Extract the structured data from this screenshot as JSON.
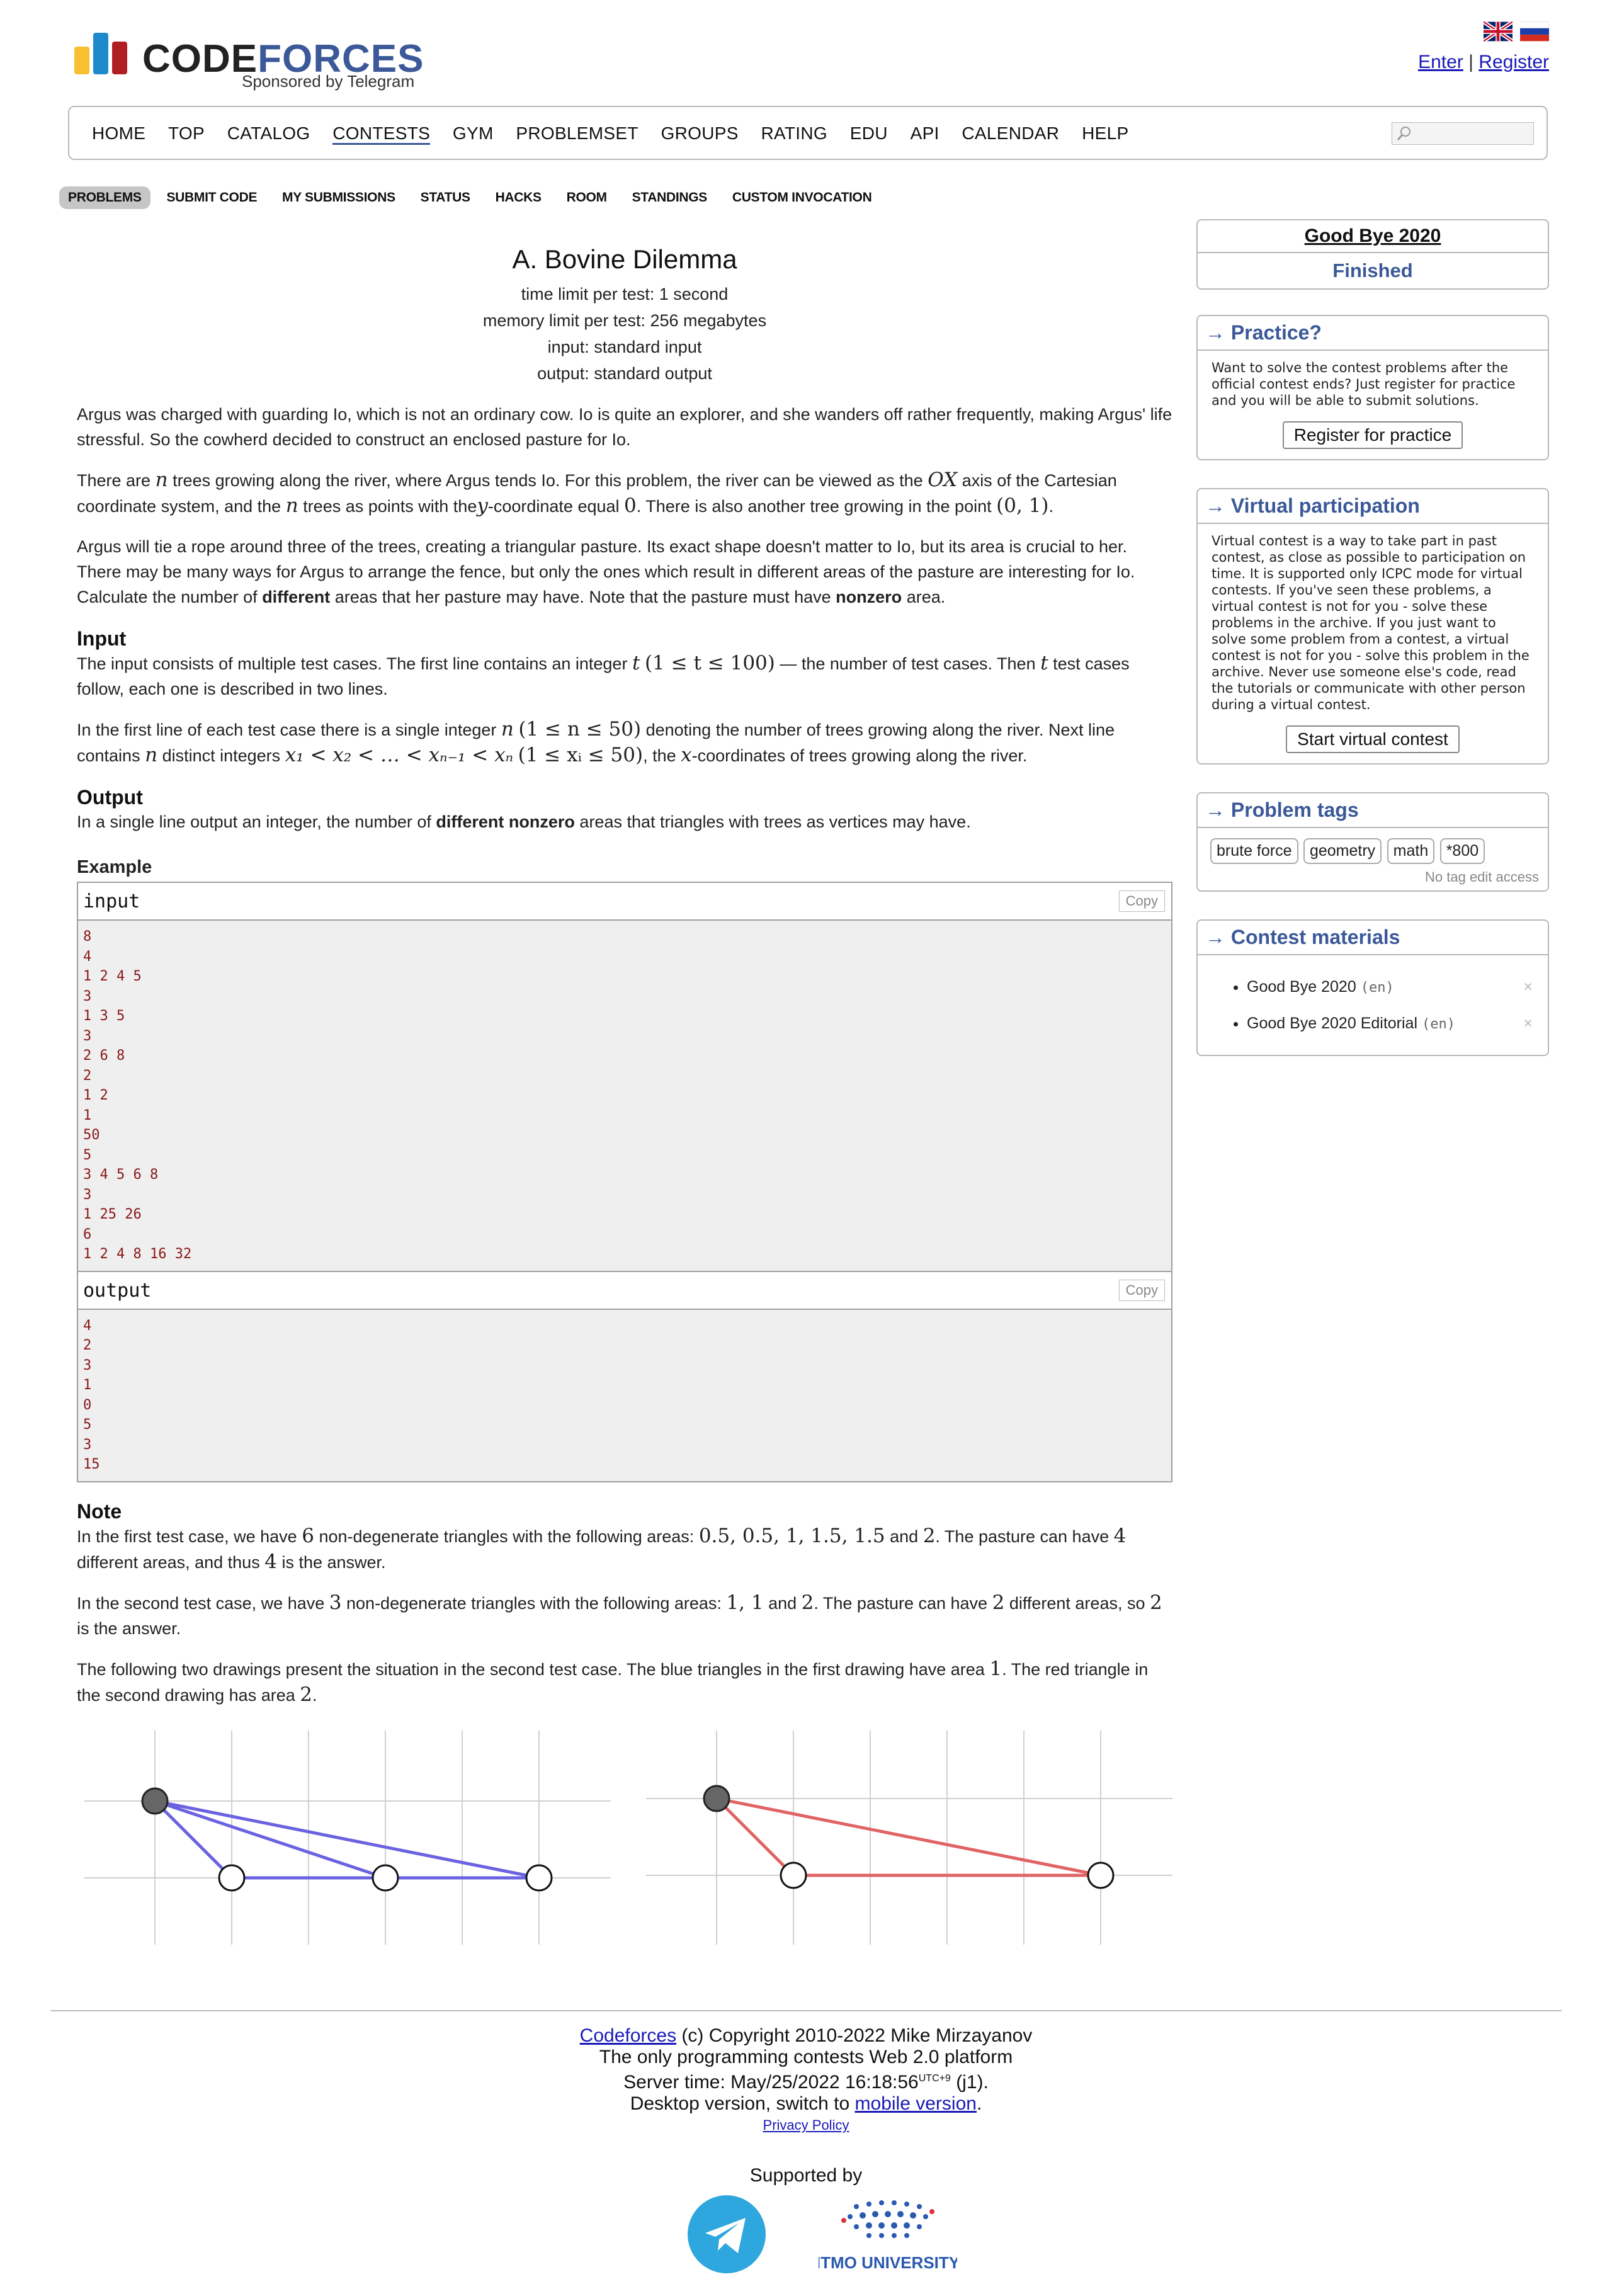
{
  "brand": {
    "name_part1": "CODE",
    "name_part2": "FORCES",
    "sponsor": "Sponsored by Telegram"
  },
  "auth": {
    "enter": "Enter",
    "separator": "|",
    "register": "Register"
  },
  "menu": [
    "HOME",
    "TOP",
    "CATALOG",
    "CONTESTS",
    "GYM",
    "PROBLEMSET",
    "GROUPS",
    "RATING",
    "EDU",
    "API",
    "CALENDAR",
    "HELP"
  ],
  "subtabs": [
    "PROBLEMS",
    "SUBMIT CODE",
    "MY SUBMISSIONS",
    "STATUS",
    "HACKS",
    "ROOM",
    "STANDINGS",
    "CUSTOM INVOCATION"
  ],
  "problem": {
    "title": "A. Bovine Dilemma",
    "time_limit": "time limit per test: 1 second",
    "memory_limit": "memory limit per test: 256 megabytes",
    "input_type": "input: standard input",
    "output_type": "output: standard output",
    "p1": "Argus was charged with guarding Io, which is not an ordinary cow. Io is quite an explorer, and she wanders off rather frequently, making Argus' life stressful. So the cowherd decided to construct an enclosed pasture for Io.",
    "p2a": "There are",
    "p2b": "trees growing along the river, where Argus tends Io. For this problem, the river can be viewed as the",
    "p2c": "axis of the Cartesian coordinate system, and the",
    "p2d": "trees as points with the",
    "p2e": "-coordinate equal",
    "p2f": ". There is also another tree growing in the point",
    "p2g": ".",
    "p3a": "Argus will tie a rope around three of the trees, creating a triangular pasture. Its exact shape doesn't matter to Io, but its area is crucial to her. There may be many ways for Argus to arrange the fence, but only the ones which result in different areas of the pasture are interesting for Io. Calculate the number of",
    "p3b": "different",
    "p3c": "areas that her pasture may have. Note that the pasture must have",
    "p3d": "nonzero",
    "p3e": "area.",
    "input_head": "Input",
    "in1a": "The input consists of multiple test cases. The first line contains an integer",
    "in1b": "— the number of test cases. Then",
    "in1c": "test cases follow, each one is described in two lines.",
    "in2a": "In the first line of each test case there is a single integer",
    "in2b": "denoting the number of trees growing along the river. Next line contains",
    "in2c": "distinct integers",
    "in2d": ", the",
    "in2e": "-coordinates of trees growing along the river.",
    "output_head": "Output",
    "out1a": "In a single line output an integer, the number of",
    "out1b": "different nonzero",
    "out1c": "areas that triangles with trees as vertices may have.",
    "example": "Example",
    "input_label": "input",
    "output_label": "output",
    "copy": "Copy",
    "input_lines": [
      "8",
      "4",
      "1 2 4 5",
      "3",
      "1 3 5",
      "3",
      "2 6 8",
      "2",
      "1 2",
      "1",
      "50",
      "5",
      "3 4 5 6 8",
      "3",
      "1 25 26",
      "6",
      "1 2 4 8 16 32"
    ],
    "output_lines": [
      "4",
      "2",
      "3",
      "1",
      "0",
      "5",
      "3",
      "15"
    ],
    "note_head": "Note",
    "n1a": "In the first test case, we have",
    "n1b": "non-degenerate triangles with the following areas:",
    "n1c": "and",
    "n1d": ". The pasture can have",
    "n1e": "different areas, and thus",
    "n1f": "is the answer.",
    "n2a": "In the second test case, we have",
    "n2b": "non-degenerate triangles with the following areas:",
    "n2c": "and",
    "n2d": ". The pasture can have",
    "n2e": "different areas, so",
    "n2f": "is the answer.",
    "n3a": "The following two drawings present the situation in the second test case. The blue triangles in the first drawing have area",
    "n3b": ". The red triangle in the second drawing has area",
    "n3c": ".",
    "math": {
      "n": "n",
      "OX": "OX",
      "y": "y",
      "zero": "0",
      "point": "(0, 1)",
      "t": "t",
      "t_range": "(1 ≤ t ≤ 100)",
      "n_range": "(1 ≤ n ≤ 50)",
      "xs": "x₁ < x₂ < … < xₙ₋₁ < xₙ",
      "xi_range": "(1 ≤ xᵢ ≤ 50)",
      "x": "x",
      "six": "6",
      "areas1": "0.5, 0.5, 1, 1.5, 1.5",
      "two": "2",
      "four": "4",
      "three": "3",
      "areas2": "1, 1",
      "one": "1"
    }
  },
  "sidebar": {
    "contest_name": "Good Bye 2020",
    "contest_status": "Finished",
    "practice_title": "→ Practice?",
    "practice_text": "Want to solve the contest problems after the official contest ends? Just register for practice and you will be able to submit solutions.",
    "practice_btn": "Register for practice",
    "virtual_title": "→ Virtual participation",
    "virtual_text": "Virtual contest is a way to take part in past contest, as close as possible to participation on time. It is supported only ICPC mode for virtual contests. If you've seen these problems, a virtual contest is not for you - solve these problems in the archive. If you just want to solve some problem from a contest, a virtual contest is not for you - solve this problem in the archive. Never use someone else's code, read the tutorials or communicate with other person during a virtual contest.",
    "virtual_btn": "Start virtual contest",
    "tags_title": "→ Problem tags",
    "tags": [
      "brute force",
      "geometry",
      "math",
      "*800"
    ],
    "tag_note": "No tag edit access",
    "materials_title": "→ Contest materials",
    "materials": [
      {
        "name": "Good Bye 2020",
        "lang": "(en)"
      },
      {
        "name": "Good Bye 2020 Editorial",
        "lang": "(en)"
      }
    ]
  },
  "footer": {
    "brand": "Codeforces",
    "copyright": " (c) Copyright 2010-2022 Mike Mirzayanov",
    "line2": "The only programming contests Web 2.0 platform",
    "server_time": "Server time: May/25/2022 16:18:56",
    "utc": "UTC+9",
    "server_tail": " (j1).",
    "desktop": "Desktop version, switch to ",
    "mobile": "mobile version",
    "dot": ".",
    "privacy": "Privacy Policy",
    "supported": "Supported by",
    "itmo": "ITMO UNIVERSITY"
  },
  "colors": {
    "accent": "#3b5998",
    "blue_triangle": "#6a62e0",
    "red_triangle": "#e06464"
  }
}
